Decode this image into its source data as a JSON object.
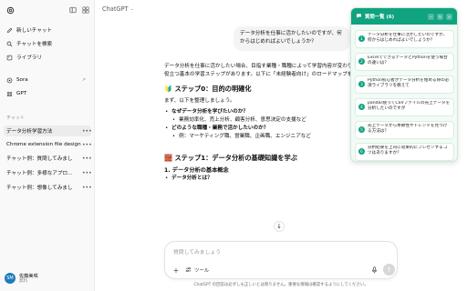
{
  "sidebar": {
    "new_chat": "新しいチャット",
    "search_chats": "チャットを検索",
    "library": "ライブラリ",
    "sora": "Sora",
    "gpt": "GPT",
    "section_label": "チャット",
    "chats": [
      {
        "label": "データ分析学習方法",
        "active": true
      },
      {
        "label": "Chrome extension file design",
        "active": false
      },
      {
        "label": "チャット例：質問してみまし",
        "active": false
      },
      {
        "label": "チャット例：多様なアプロ…",
        "active": false
      },
      {
        "label": "チャット例：想像してみまし",
        "active": false
      }
    ],
    "user": {
      "name": "佐藤美咲",
      "plan": "無料",
      "initials": "SM"
    }
  },
  "main": {
    "model": "ChatGPT",
    "user_message": "データ分析を仕事に活かしたいのですが、何からはじめればよいでしょうか？",
    "intro": "データ分析を仕事に活かしたい場合、目指す業種・職種によって学習内容が変わりますが、共通して役立つ基本の学習ステップがあります。以下に「未経験者向け」のロードマップを紹介します。",
    "step0_title": "🔰 ステップ0：目的の明確化",
    "step0_lead": "まず、以下を整理しましょう。",
    "q1": "なぜデータ分析を学びたいのか？",
    "q1_example": "業務効率化、売上分析、顧客分析、意思決定の支援など",
    "q2": "どのような職種・業務で活かしたいのか？",
    "q2_example": "例：マーケティング職、営業職、企画職、エンジニアなど",
    "step1_title": "🧱 ステップ1：データ分析の基礎知識を学ぶ",
    "step1_sub": "1. データ分析の基本概念",
    "step1_item": "データ分析とは？"
  },
  "composer": {
    "placeholder": "質問してみましょう",
    "tools_label": "ツール",
    "disclaimer": "ChatGPT の回答は必ずしも正しいとは限りません。重要な情報は確認するようにしてください。"
  },
  "question_panel": {
    "title": "質問一覧 (6)",
    "accent": "#10a37f",
    "items": [
      {
        "num": "1",
        "text": "データ分析を仕事に活かしたいのですが、何からはじめればよいでしょうか？"
      },
      {
        "num": "2",
        "text": "ExcelでできるデータとPythonを使う場合の違いは？"
      },
      {
        "num": "3",
        "text": "Python初心者がデータ分析を始める際の必須ライブラリを教えて"
      },
      {
        "num": "4",
        "text": "pandas使ってCSVファイルの売上データを分析したいのですが"
      },
      {
        "num": "5",
        "text": "売上データから季節性やトレンドを見つける方法は？"
      },
      {
        "num": "6",
        "text": "分析結果を上司に効果的にプレゼンするコツはありますか？"
      }
    ]
  }
}
